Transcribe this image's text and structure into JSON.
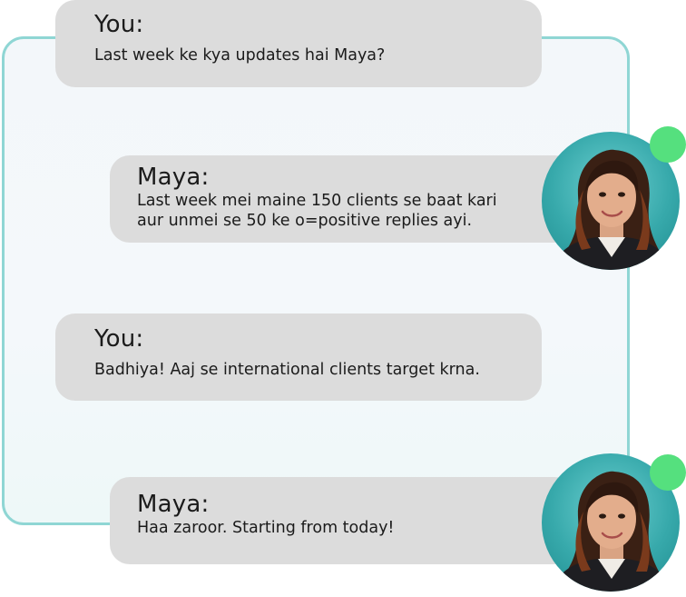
{
  "chat": {
    "messages": [
      {
        "sender": "You:",
        "text": "Last week ke kya updates hai Maya?"
      },
      {
        "sender": "Maya:",
        "text_line1": "Last week mei maine 150 clients se baat kari",
        "text_line2": "aur unmei se 50 ke o=positive replies ayi."
      },
      {
        "sender": "You:",
        "text": "Badhiya! Aaj se international clients target krna."
      },
      {
        "sender": "Maya:",
        "text": "Haa zaroor. Starting from today!"
      }
    ]
  },
  "colors": {
    "bubble": "#dcdcdc",
    "panel_border": "#8fd6d4",
    "online_dot": "#55e07e",
    "avatar_bg": "#37a9ab"
  },
  "icons": {
    "avatar": "maya-avatar-photo",
    "status": "online-status-dot"
  }
}
